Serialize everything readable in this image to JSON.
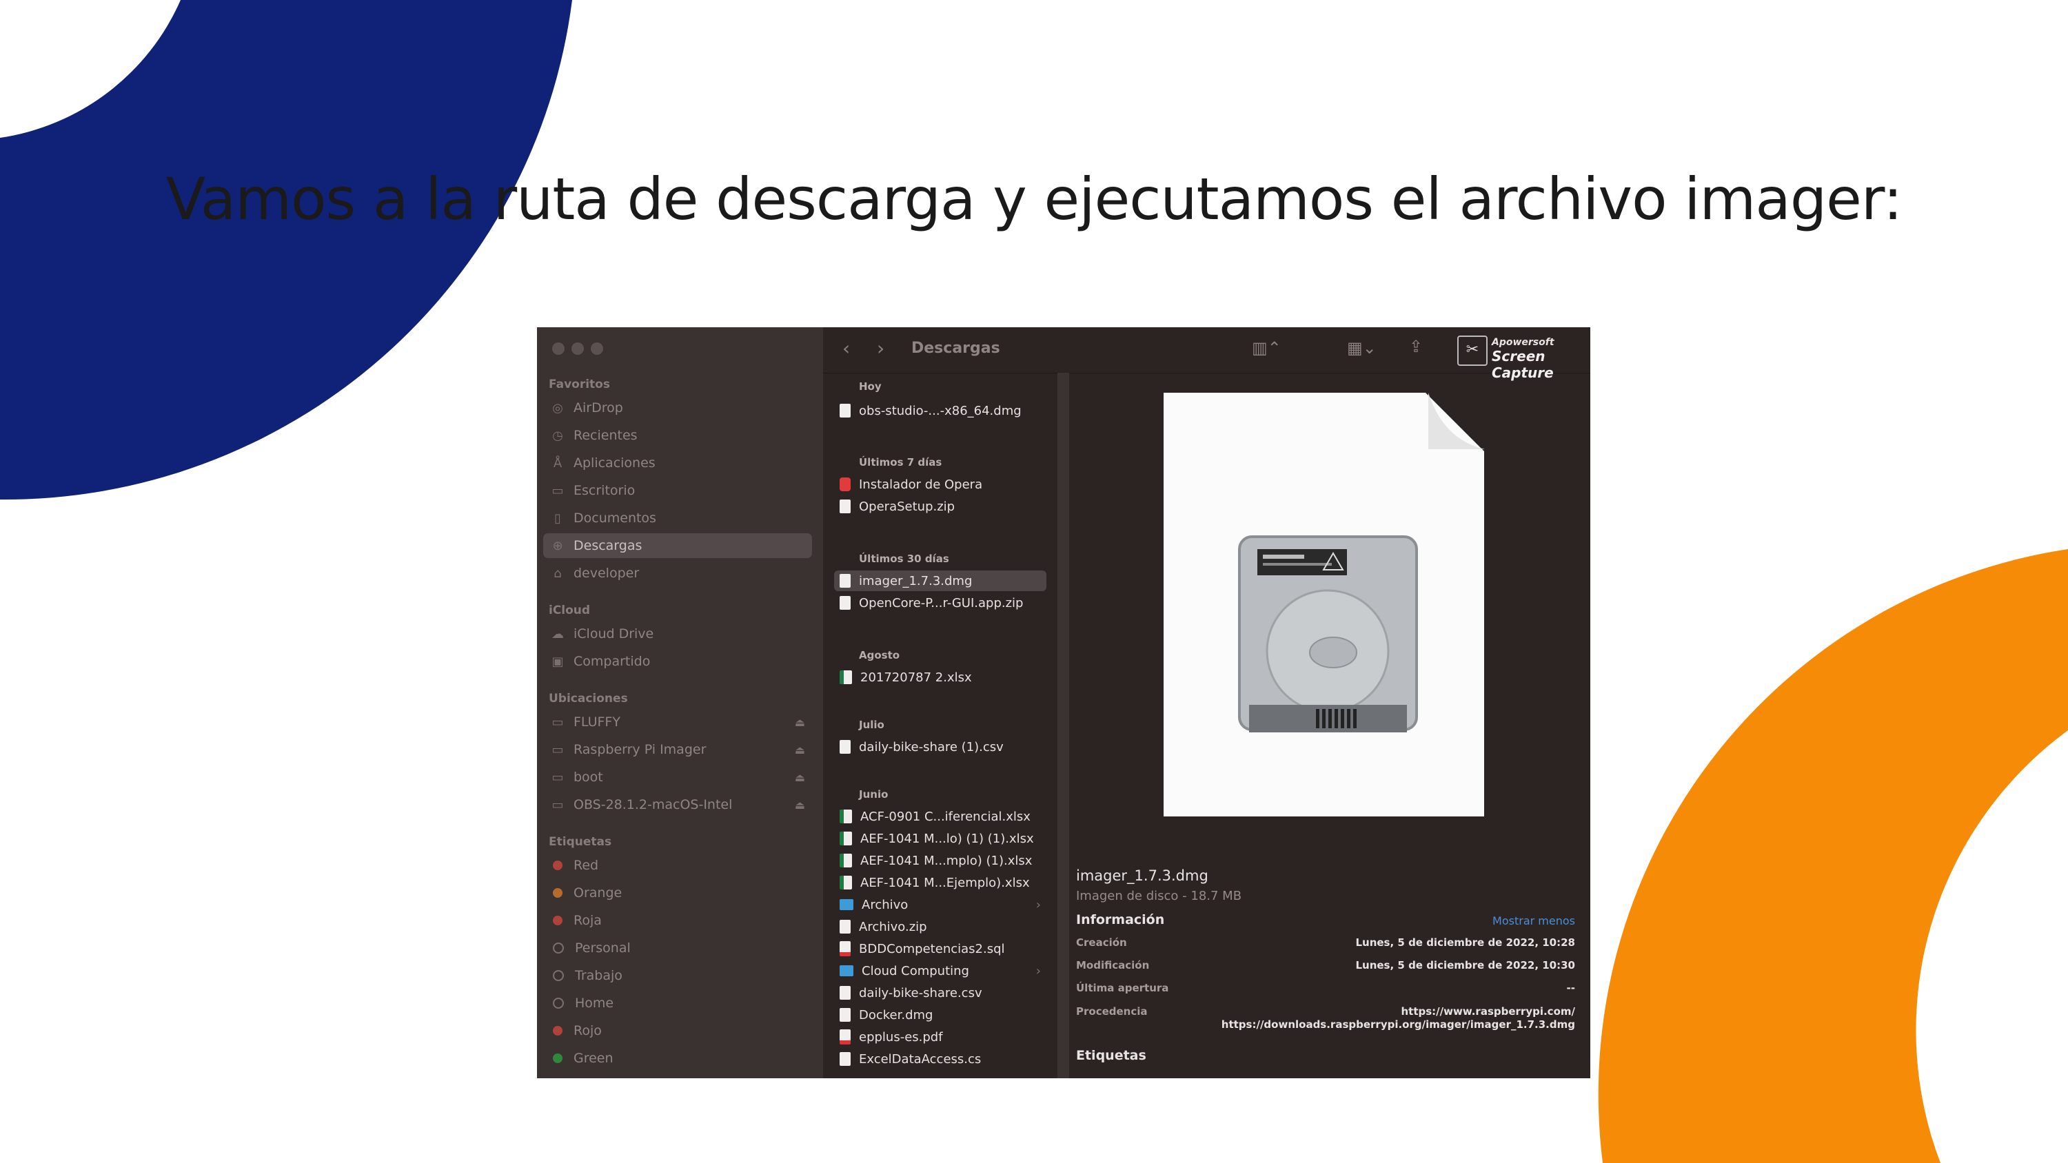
{
  "slide": {
    "title": "Vamos a la ruta de descarga y ejecutamos el archivo imager:"
  },
  "colors": {
    "navy": "#0f2277",
    "orange": "#f68b08"
  },
  "finder": {
    "path_title": "Descargas",
    "watermark": {
      "line1": "Apowersoft",
      "line2": "Screen Capture"
    },
    "sidebar": {
      "favorites_label": "Favoritos",
      "favorites": [
        {
          "label": "AirDrop",
          "icon": "airdrop-icon"
        },
        {
          "label": "Recientes",
          "icon": "clock-icon"
        },
        {
          "label": "Aplicaciones",
          "icon": "apps-icon"
        },
        {
          "label": "Escritorio",
          "icon": "desktop-icon"
        },
        {
          "label": "Documentos",
          "icon": "document-icon"
        },
        {
          "label": "Descargas",
          "icon": "download-icon"
        },
        {
          "label": "developer",
          "icon": "home-icon"
        }
      ],
      "icloud_label": "iCloud",
      "icloud": [
        {
          "label": "iCloud Drive",
          "icon": "cloud-icon"
        },
        {
          "label": "Compartido",
          "icon": "shared-folder-icon"
        }
      ],
      "locations_label": "Ubicaciones",
      "locations": [
        {
          "label": "FLUFFY",
          "icon": "drive-icon"
        },
        {
          "label": "Raspberry Pi Imager",
          "icon": "drive-icon"
        },
        {
          "label": "boot",
          "icon": "drive-icon"
        },
        {
          "label": "OBS-28.1.2-macOS-Intel",
          "icon": "drive-icon"
        }
      ],
      "tags_label": "Etiquetas",
      "tags": [
        {
          "label": "Red",
          "color": "#c0392b"
        },
        {
          "label": "Orange",
          "color": "#d2691e"
        },
        {
          "label": "Roja",
          "color": "#c0392b"
        },
        {
          "label": "Personal",
          "color": ""
        },
        {
          "label": "Trabajo",
          "color": ""
        },
        {
          "label": "Home",
          "color": ""
        },
        {
          "label": "Rojo",
          "color": "#c0392b"
        },
        {
          "label": "Green",
          "color": "#2e9e3e"
        }
      ]
    },
    "groups": {
      "hoy": "Hoy",
      "ultimos7": "Últimos 7 días",
      "ultimos30": "Últimos 30 días",
      "agosto": "Agosto",
      "julio": "Julio",
      "junio": "Junio"
    },
    "files": {
      "hoy": [
        "obs-studio-...-x86_64.dmg"
      ],
      "ultimos7": [
        "Instalador de Opera",
        "OperaSetup.zip"
      ],
      "ultimos30": [
        "imager_1.7.3.dmg",
        "OpenCore-P...r-GUI.app.zip"
      ],
      "agosto": [
        "201720787 2.xlsx"
      ],
      "julio": [
        "daily-bike-share (1).csv"
      ],
      "junio": [
        "ACF-0901 C...iferencial.xlsx",
        "AEF-1041 M...lo) (1) (1).xlsx",
        "AEF-1041 M...mplo) (1).xlsx",
        "AEF-1041 M...Ejemplo).xlsx",
        "Archivo",
        "Archivo.zip",
        "BDDCompetencias2.sql",
        "Cloud Computing",
        "daily-bike-share.csv",
        "Docker.dmg",
        "epplus-es.pdf",
        "ExcelDataAccess.cs"
      ]
    },
    "preview": {
      "file_name": "imager_1.7.3.dmg",
      "file_kind": "Imagen de disco - 18.7 MB",
      "info_label": "Información",
      "show_less": "Mostrar menos",
      "rows": [
        {
          "key": "Creación",
          "value": "Lunes, 5 de diciembre de 2022, 10:28"
        },
        {
          "key": "Modificación",
          "value": "Lunes, 5 de diciembre de 2022, 10:30"
        },
        {
          "key": "Última apertura",
          "value": "--"
        },
        {
          "key": "Procedencia",
          "value": "https://www.raspberrypi.com/",
          "value2": "https://downloads.raspberrypi.org/imager/imager_1.7.3.dmg"
        }
      ],
      "tags_label": "Etiquetas"
    }
  }
}
